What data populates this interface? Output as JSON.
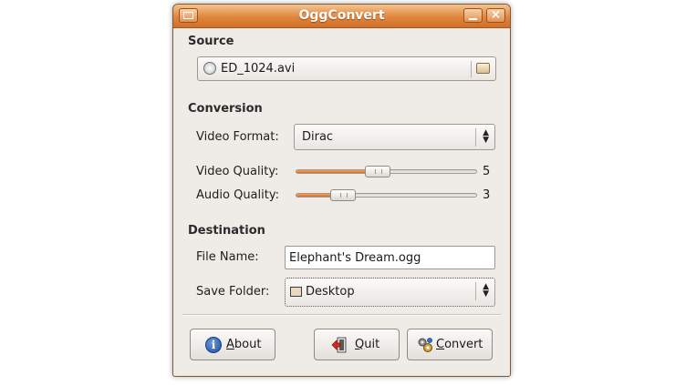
{
  "window": {
    "title": "OggConvert"
  },
  "source": {
    "heading": "Source",
    "file": "ED_1024.avi"
  },
  "conversion": {
    "heading": "Conversion",
    "video_format_label": "Video Format:",
    "video_format_value": "Dirac",
    "video_quality_label": "Video Quality:",
    "video_quality_value": "5",
    "video_quality_fraction": 0.45,
    "audio_quality_label": "Audio Quality:",
    "audio_quality_value": "3",
    "audio_quality_fraction": 0.26
  },
  "destination": {
    "heading": "Destination",
    "file_name_label": "File Name:",
    "file_name_value": "Elephant's Dream.ogg",
    "save_folder_label": "Save Folder:",
    "save_folder_value": "Desktop"
  },
  "buttons": {
    "about_first": "A",
    "about_rest": "bout",
    "quit_first": "Q",
    "quit_rest": "uit",
    "convert_first": "C",
    "convert_rest": "onvert"
  },
  "colors": {
    "titlebar": "#e0863f",
    "slider_fill": "#dc6b1f",
    "window_bg": "#efebe7"
  },
  "icons": {
    "about": "info-icon",
    "quit": "exit-icon",
    "convert": "convert-gears-icon",
    "source": "file-icon",
    "browse": "folder-icon",
    "save_folder": "desktop-icon"
  }
}
